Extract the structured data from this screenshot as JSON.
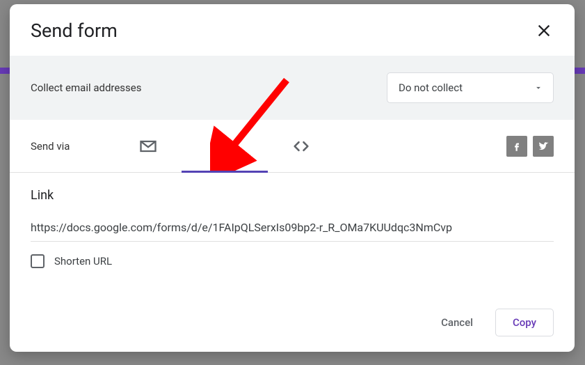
{
  "dialog": {
    "title": "Send form",
    "collect_label": "Collect email addresses",
    "collect_select_value": "Do not collect",
    "send_via_label": "Send via"
  },
  "tabs": {
    "email": "email",
    "link": "link",
    "embed": "embed",
    "active": "link"
  },
  "link_section": {
    "heading": "Link",
    "url": "https://docs.google.com/forms/d/e/1FAIpQLSerxIs09bp2-r_R_OMa7KUUdqc3NmCvp",
    "shorten_label": "Shorten URL"
  },
  "footer": {
    "cancel": "Cancel",
    "copy": "Copy"
  },
  "social": {
    "facebook": "facebook",
    "twitter": "twitter"
  },
  "annotation": {
    "arrow_color": "#ff0000"
  }
}
